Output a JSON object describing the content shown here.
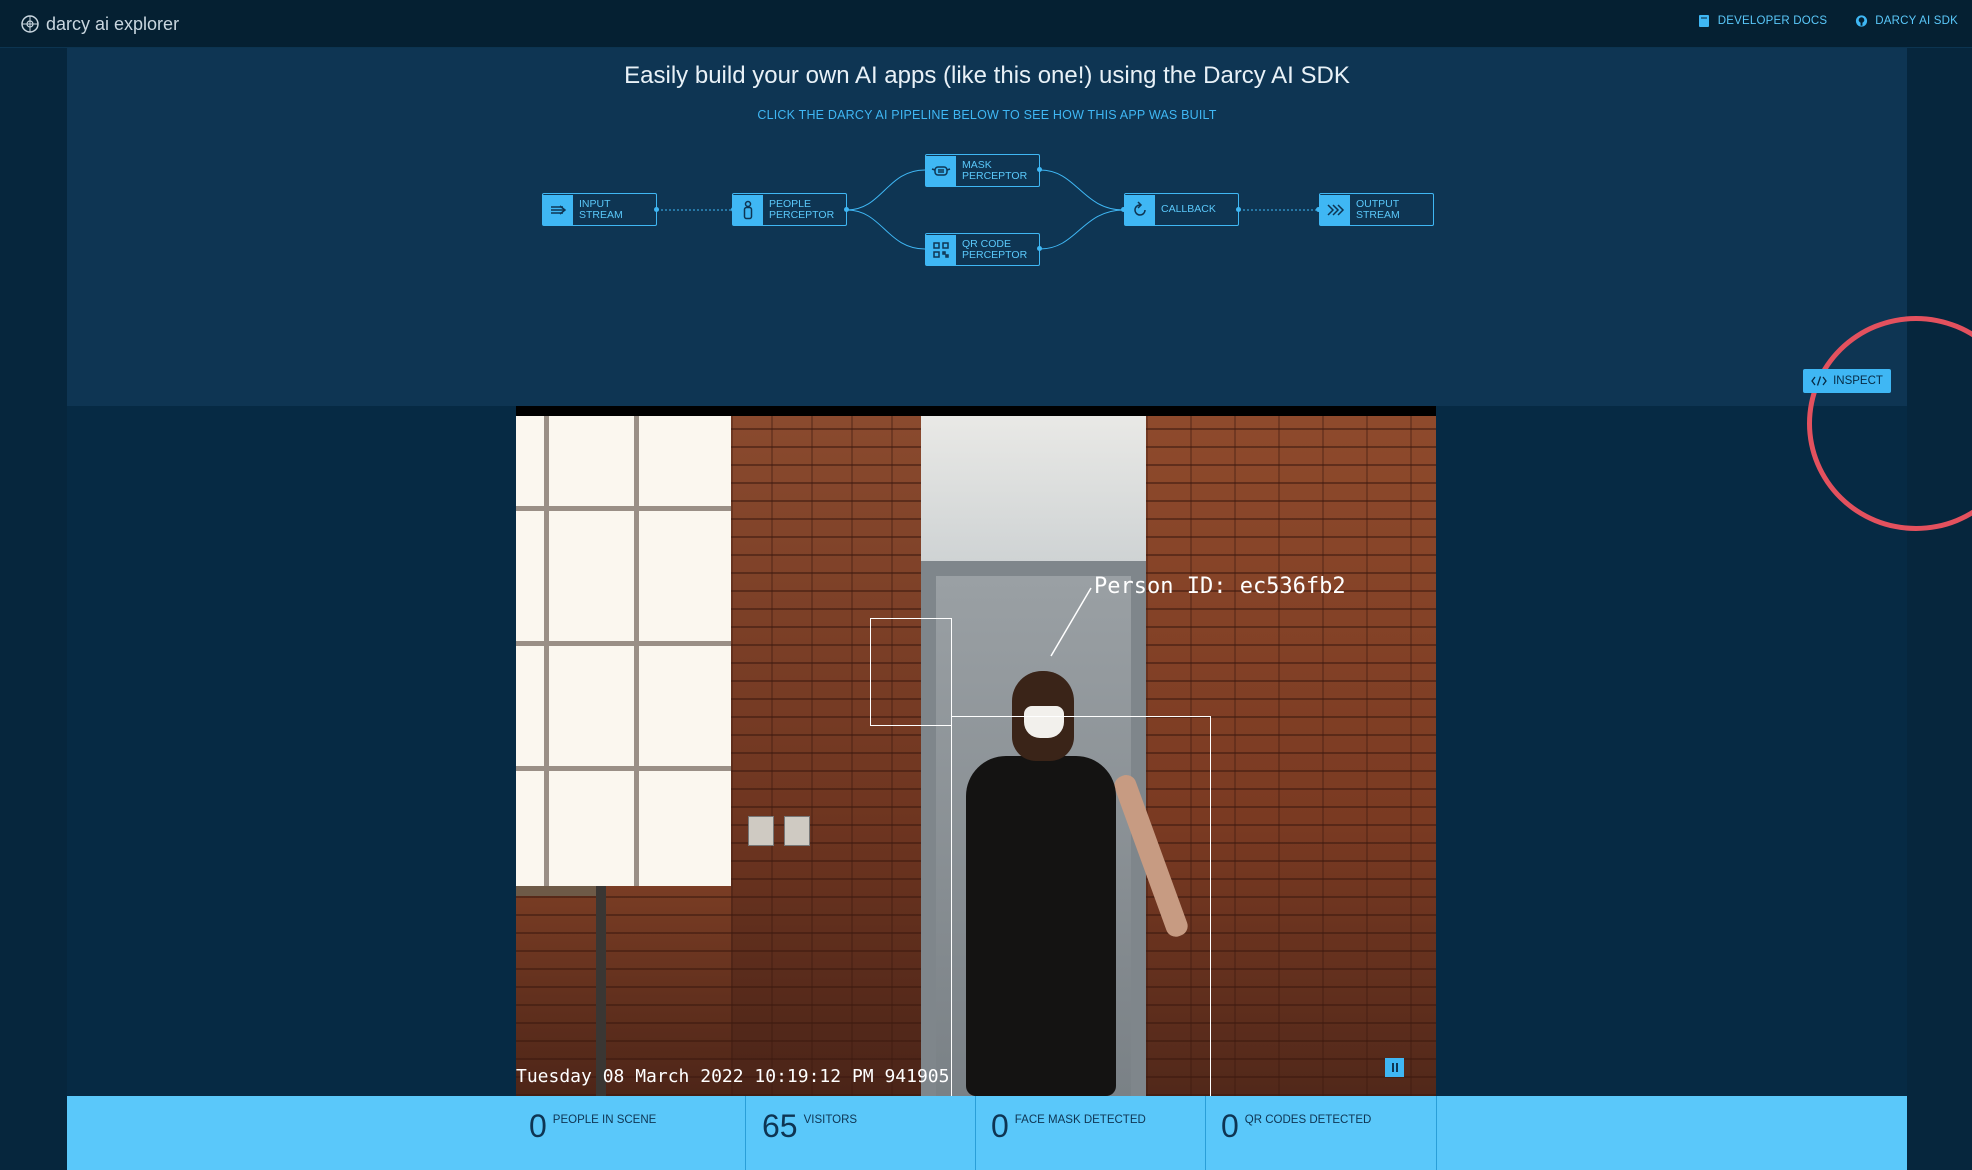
{
  "topbar": {
    "brand": "darcy ai explorer",
    "links": [
      {
        "label": "DEVELOPER DOCS",
        "icon": "book-icon"
      },
      {
        "label": "DARCY AI SDK",
        "icon": "github-icon"
      }
    ]
  },
  "hero": {
    "title": "Easily build your own AI apps (like this one!) using the Darcy AI SDK",
    "subtitle": "CLICK THE DARCY AI PIPELINE BELOW TO SEE HOW THIS APP WAS BUILT"
  },
  "pipeline": {
    "nodes": [
      {
        "label": "INPUT\nSTREAM",
        "icon": "input-arrow-icon"
      },
      {
        "label": "PEOPLE\nPERCEPTOR",
        "icon": "person-icon"
      },
      {
        "label": "MASK\nPERCEPTOR",
        "icon": "mask-icon"
      },
      {
        "label": "QR CODE\nPERCEPTOR",
        "icon": "qr-code-icon"
      },
      {
        "label": "CALLBACK",
        "icon": "callback-icon"
      },
      {
        "label": "OUTPUT\nSTREAM",
        "icon": "output-arrows-icon"
      }
    ]
  },
  "inspect": {
    "label": "INSPECT",
    "icon": "code-icon"
  },
  "video": {
    "person_id": "Person ID: ec536fb2",
    "timestamp": "Tuesday 08 March 2022 10:19:12 PM 941905",
    "pause_icon": "pause-icon"
  },
  "stats": [
    {
      "value": "0",
      "label": "PEOPLE IN SCENE"
    },
    {
      "value": "65",
      "label": "VISITORS"
    },
    {
      "value": "0",
      "label": "FACE MASK DETECTED"
    },
    {
      "value": "0",
      "label": "QR CODES DETECTED"
    }
  ],
  "colors": {
    "background": "#06263d",
    "hero": "#0e3553",
    "accent": "#3fb7f4",
    "stats_bar": "#5ac8fa",
    "highlight_ring": "#e3515e"
  }
}
